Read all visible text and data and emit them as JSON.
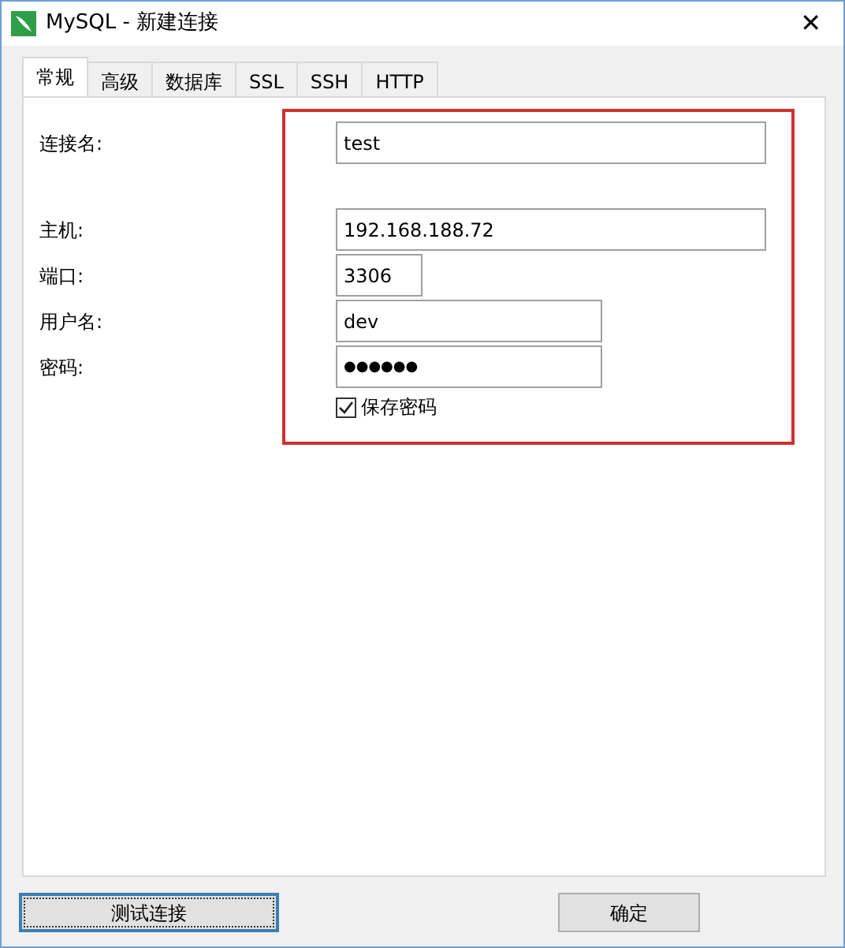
{
  "window": {
    "title": "MySQL - 新建连接",
    "close": "✕"
  },
  "tabs": [
    {
      "label": "常规",
      "selected": true
    },
    {
      "label": "高级",
      "selected": false
    },
    {
      "label": "数据库",
      "selected": false
    },
    {
      "label": "SSL",
      "selected": false
    },
    {
      "label": "SSH",
      "selected": false
    },
    {
      "label": "HTTP",
      "selected": false
    }
  ],
  "connection_name": {
    "label": "连接名:",
    "value": "test",
    "kind": "wide"
  },
  "fields": [
    {
      "label": "主机:",
      "value": "192.168.188.72",
      "kind": "wide"
    },
    {
      "label": "端口:",
      "value": "3306",
      "kind": "short"
    },
    {
      "label": "用户名:",
      "value": "dev",
      "kind": "medium"
    },
    {
      "label": "密码:",
      "value": "●●●●●●",
      "kind": "password"
    }
  ],
  "save_password": {
    "label": "保存密码",
    "checked": true
  },
  "highlight": true,
  "buttons": [
    {
      "label": "测试连接",
      "focused": true
    },
    {
      "label": "确定",
      "focused": false
    }
  ]
}
